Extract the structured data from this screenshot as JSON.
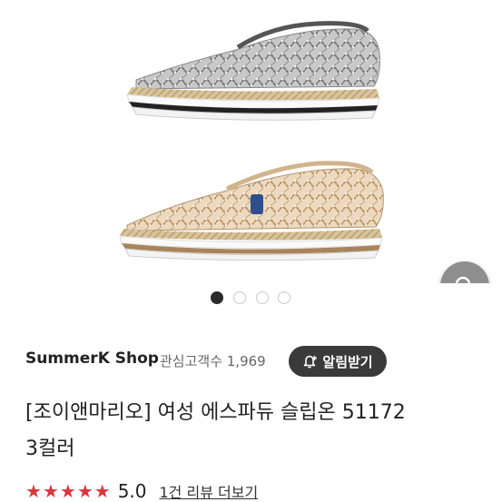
{
  "product_images": {
    "current_index": 1,
    "total": 4,
    "image_1_alt": "silver and gold lace espadrille slip-ons"
  },
  "search_button": {
    "icon": "search-icon"
  },
  "shop": {
    "name": "SummerK Shop",
    "follower_count": "관심고객수 1,969",
    "alert_button_label": "알림받기",
    "alert_icon": "bell-plus-icon"
  },
  "product": {
    "title_line1": "[조이앤마리오] 여성 에스파듀 슬립온 51172",
    "title_line2": "3컬러"
  },
  "rating": {
    "stars": 5,
    "score": "5.0",
    "review_link": "1건 리뷰 더보기",
    "star_color": "#d9363e"
  }
}
